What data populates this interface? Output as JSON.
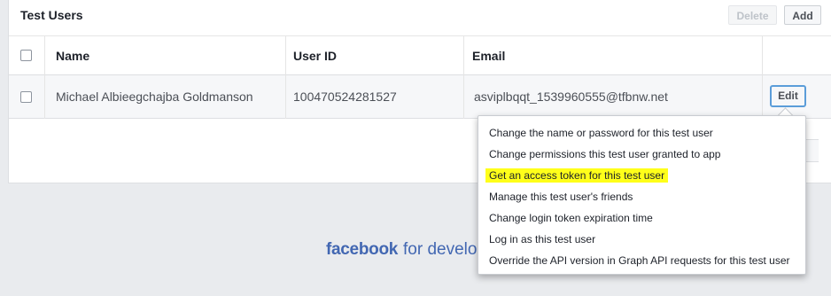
{
  "panel": {
    "title": "Test Users",
    "delete_label": "Delete",
    "add_label": "Add"
  },
  "table": {
    "columns": [
      "Name",
      "User ID",
      "Email"
    ],
    "rows": [
      {
        "name": "Michael Albieegchajba Goldmanson",
        "user_id": "100470524281527",
        "email": "asviplbqqt_1539960555@tfbnw.net",
        "edit_label": "Edit"
      }
    ]
  },
  "menu": {
    "items": [
      "Change the name or password for this test user",
      "Change permissions this test user granted to app",
      "Get an access token for this test user",
      "Manage this test user's friends",
      "Change login token expiration time",
      "Log in as this test user",
      "Override the API version in Graph API requests for this test user"
    ],
    "highlighted_index": 2,
    "highlight_color": "#ffff1a"
  },
  "footer": {
    "brand": "facebook",
    "tagline": "for develo"
  },
  "colors": {
    "background": "#e9ebee",
    "brand_blue": "#4267b2",
    "focus_ring": "#5b9dd9"
  }
}
